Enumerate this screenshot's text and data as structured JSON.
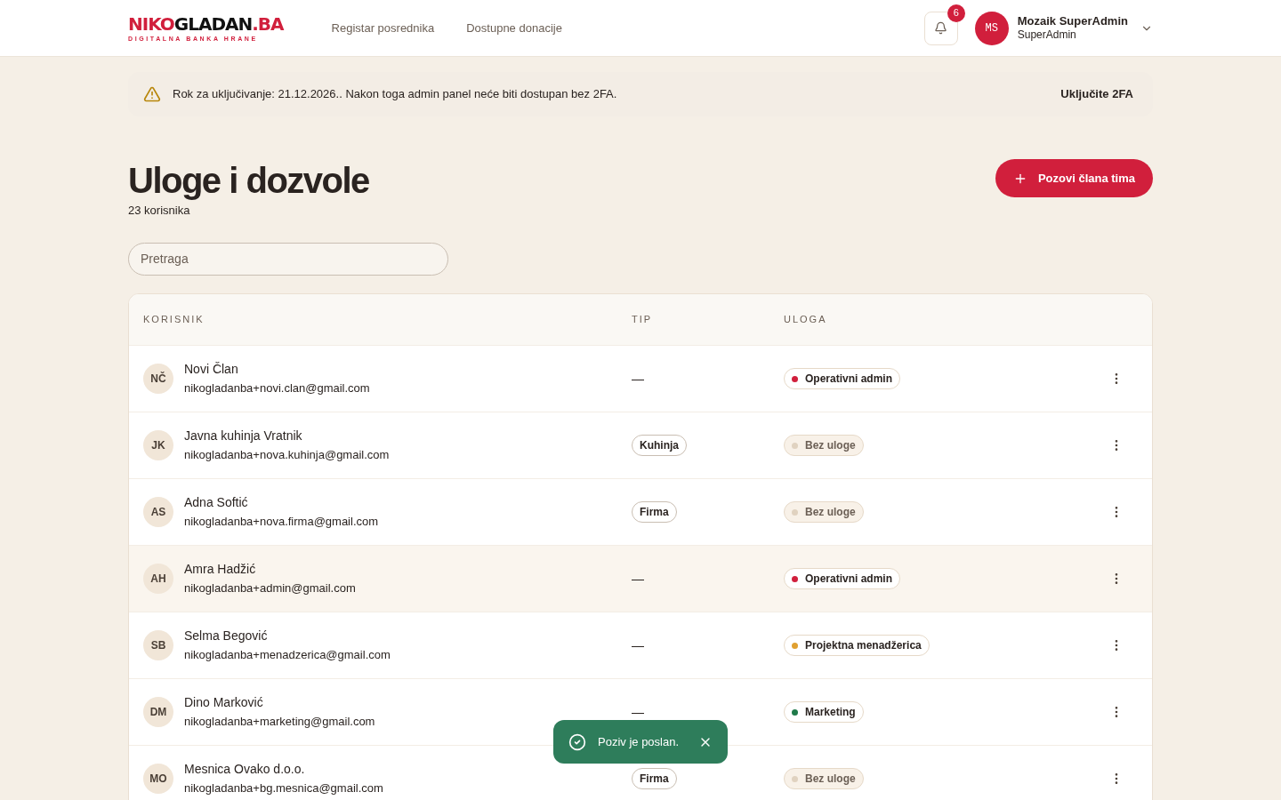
{
  "header": {
    "logo": {
      "parts": [
        {
          "text": "NIKO",
          "color": "#d11f3c"
        },
        {
          "text": "GLADAN",
          "color": "#111111"
        },
        {
          "text": ".BA",
          "color": "#d11f3c"
        }
      ],
      "tagline": "DIGITALNA BANKA HRANE"
    },
    "nav": [
      "Registar posrednika",
      "Dostupne donacije"
    ],
    "notifications": {
      "count": "6"
    },
    "user": {
      "initials": "MS",
      "name": "Mozaik SuperAdmin",
      "role": "SuperAdmin"
    }
  },
  "alert": {
    "text": "Rok za uključivanje: 21.12.2026.. Nakon toga admin panel neće biti dostupan bez 2FA.",
    "action": "Uključite 2FA"
  },
  "page": {
    "title": "Uloge i dozvole",
    "subtitle": "23 korisnika",
    "invite_button": "Pozovi člana tima"
  },
  "search": {
    "placeholder": "Pretraga"
  },
  "table": {
    "columns": [
      "KORISNIK",
      "TIP",
      "ULOGA"
    ],
    "rows": [
      {
        "initials": "NČ",
        "name": "Novi Član",
        "email": "nikogladanba+novi.clan@gmail.com",
        "type": {
          "kind": "dash",
          "text": "—"
        },
        "role": {
          "kind": "assigned",
          "text": "Operativni admin",
          "color": "#d11f3c"
        },
        "highlighted": false
      },
      {
        "initials": "JK",
        "name": "Javna kuhinja Vratnik",
        "email": "nikogladanba+nova.kuhinja@gmail.com",
        "type": {
          "kind": "badge",
          "text": "Kuhinja"
        },
        "role": {
          "kind": "empty",
          "text": "Bez uloge",
          "color": "#e0d2c0"
        },
        "highlighted": false
      },
      {
        "initials": "AS",
        "name": "Adna Softić",
        "email": "nikogladanba+nova.firma@gmail.com",
        "type": {
          "kind": "badge",
          "text": "Firma"
        },
        "role": {
          "kind": "empty",
          "text": "Bez uloge",
          "color": "#e0d2c0"
        },
        "highlighted": false
      },
      {
        "initials": "AH",
        "name": "Amra Hadžić",
        "email": "nikogladanba+admin@gmail.com",
        "type": {
          "kind": "dash",
          "text": "—"
        },
        "role": {
          "kind": "assigned",
          "text": "Operativni admin",
          "color": "#d11f3c"
        },
        "highlighted": true
      },
      {
        "initials": "SB",
        "name": "Selma Begović",
        "email": "nikogladanba+menadzerica@gmail.com",
        "type": {
          "kind": "dash",
          "text": "—"
        },
        "role": {
          "kind": "assigned",
          "text": "Projektna menadžerica",
          "color": "#e0a030"
        },
        "highlighted": false
      },
      {
        "initials": "DM",
        "name": "Dino Marković",
        "email": "nikogladanba+marketing@gmail.com",
        "type": {
          "kind": "dash",
          "text": "—"
        },
        "role": {
          "kind": "assigned",
          "text": "Marketing",
          "color": "#1f7a4a"
        },
        "highlighted": false
      },
      {
        "initials": "MO",
        "name": "Mesnica Ovako d.o.o.",
        "email": "nikogladanba+bg.mesnica@gmail.com",
        "type": {
          "kind": "badge",
          "text": "Firma"
        },
        "role": {
          "kind": "empty",
          "text": "Bez uloge",
          "color": "#e0d2c0"
        },
        "highlighted": false
      }
    ]
  },
  "toast": {
    "text": "Poziv je poslan."
  }
}
